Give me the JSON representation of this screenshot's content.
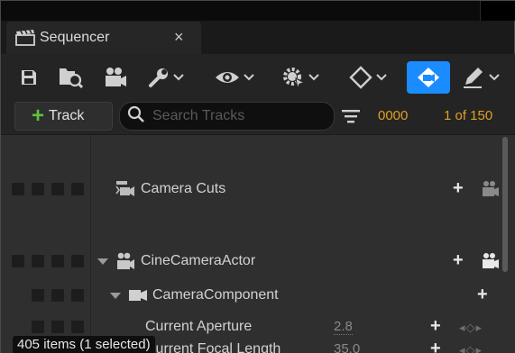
{
  "tab": {
    "title": "Sequencer",
    "close": "×"
  },
  "toolbar": {
    "icons": [
      "save-icon",
      "find-in-browser-icon",
      "camera-icon",
      "wrench-icon",
      "eye-icon",
      "gear-icon",
      "diamond-key-icon",
      "camera-lock-icon",
      "pencil-icon"
    ],
    "active": "camera-lock-icon",
    "accent_color": "#1a8cff"
  },
  "add_track": {
    "plus": "+",
    "label": "Track"
  },
  "search": {
    "placeholder": "Search Tracks",
    "value": ""
  },
  "time": {
    "current": "0000",
    "frames": "1 of 150"
  },
  "tracks": [
    {
      "label": "Camera Cuts",
      "icon": "camera-cuts-icon"
    },
    {
      "label": "CineCameraActor",
      "icon": "cine-camera-actor-icon"
    },
    {
      "label": "CameraComponent",
      "icon": "camera-component-icon"
    },
    {
      "label": "Current Aperture",
      "value": "2.8"
    },
    {
      "label": "Current Focal Length",
      "value": "35.0"
    }
  ],
  "status": {
    "text": "405 items (1 selected)"
  },
  "colors": {
    "timecode": "#e0a020",
    "plus_green": "#5fc23a"
  }
}
